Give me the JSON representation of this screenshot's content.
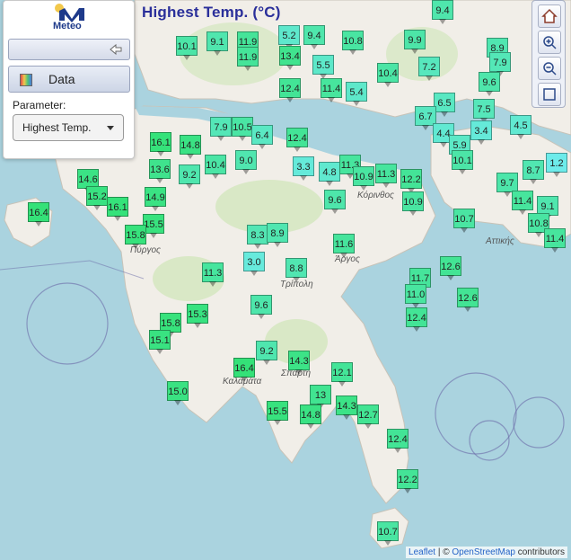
{
  "header": {
    "title": "Highest Temp. (°C)"
  },
  "logo": {
    "text": "Meteo"
  },
  "panel": {
    "data_label": "Data",
    "parameter_label": "Parameter:",
    "parameter_value": "Highest Temp."
  },
  "map_controls": [
    "home-icon",
    "zoom-in-icon",
    "zoom-out-icon",
    "fullscreen-icon"
  ],
  "places": [
    {
      "name": "Πύργος"
    },
    {
      "name": "Τρίπολη"
    },
    {
      "name": "Άργος"
    },
    {
      "name": "Σπάρτη"
    },
    {
      "name": "Καλαμάτα"
    },
    {
      "name": "Κόρινθος"
    },
    {
      "name": "Αττικής"
    }
  ],
  "stations": [
    {
      "v": "9.4"
    },
    {
      "v": "10.1"
    },
    {
      "v": "9.1"
    },
    {
      "v": "11.9"
    },
    {
      "v": "5.2"
    },
    {
      "v": "9.4"
    },
    {
      "v": "10.8"
    },
    {
      "v": "9.9"
    },
    {
      "v": "8.9"
    },
    {
      "v": "11.9"
    },
    {
      "v": "13.4"
    },
    {
      "v": "5.5"
    },
    {
      "v": "10.4"
    },
    {
      "v": "7.2"
    },
    {
      "v": "7.9"
    },
    {
      "v": "12.4"
    },
    {
      "v": "11.4"
    },
    {
      "v": "5.4"
    },
    {
      "v": "9.6"
    },
    {
      "v": "6.5"
    },
    {
      "v": "7.5"
    },
    {
      "v": "6.7"
    },
    {
      "v": "3.4"
    },
    {
      "v": "4.4"
    },
    {
      "v": "7.9"
    },
    {
      "v": "10.5"
    },
    {
      "v": "6.4"
    },
    {
      "v": "12.4"
    },
    {
      "v": "5.9"
    },
    {
      "v": "16.1"
    },
    {
      "v": "14.8"
    },
    {
      "v": "9.0"
    },
    {
      "v": "3.3"
    },
    {
      "v": "4.8"
    },
    {
      "v": "11.3"
    },
    {
      "v": "10.9"
    },
    {
      "v": "11.3"
    },
    {
      "v": "12.2"
    },
    {
      "v": "10.1"
    },
    {
      "v": "9.7"
    },
    {
      "v": "13.6"
    },
    {
      "v": "9.2"
    },
    {
      "v": "10.4"
    },
    {
      "v": "14.6"
    },
    {
      "v": "15.2"
    },
    {
      "v": "16.1"
    },
    {
      "v": "14.9"
    },
    {
      "v": "9.6"
    },
    {
      "v": "10.9"
    },
    {
      "v": "11.4"
    },
    {
      "v": "9.1"
    },
    {
      "v": "16.4"
    },
    {
      "v": "15.5"
    },
    {
      "v": "15.8"
    },
    {
      "v": "8.3"
    },
    {
      "v": "8.9"
    },
    {
      "v": "10.7"
    },
    {
      "v": "10.8"
    },
    {
      "v": "11.4"
    },
    {
      "v": "3.0"
    },
    {
      "v": "11.6"
    },
    {
      "v": "8.8"
    },
    {
      "v": "12.6"
    },
    {
      "v": "11.3"
    },
    {
      "v": "11.7"
    },
    {
      "v": "11.0"
    },
    {
      "v": "12.6"
    },
    {
      "v": "12.4"
    },
    {
      "v": "9.6"
    },
    {
      "v": "15.3"
    },
    {
      "v": "15.8"
    },
    {
      "v": "15.1"
    },
    {
      "v": "9.2"
    },
    {
      "v": "14.3"
    },
    {
      "v": "16.4"
    },
    {
      "v": "12.1"
    },
    {
      "v": "15.0"
    },
    {
      "v": "13"
    },
    {
      "v": "14.3"
    },
    {
      "v": "12.7"
    },
    {
      "v": "15.5"
    },
    {
      "v": "14.8"
    },
    {
      "v": "12.4"
    },
    {
      "v": "12.2"
    },
    {
      "v": "10.7"
    },
    {
      "v": "8.7"
    },
    {
      "v": "1.2"
    },
    {
      "v": "4.5"
    }
  ],
  "attribution": {
    "leaflet": "Leaflet",
    "sep": " | © ",
    "osm": "OpenStreetMap",
    "suffix": " contributors"
  }
}
